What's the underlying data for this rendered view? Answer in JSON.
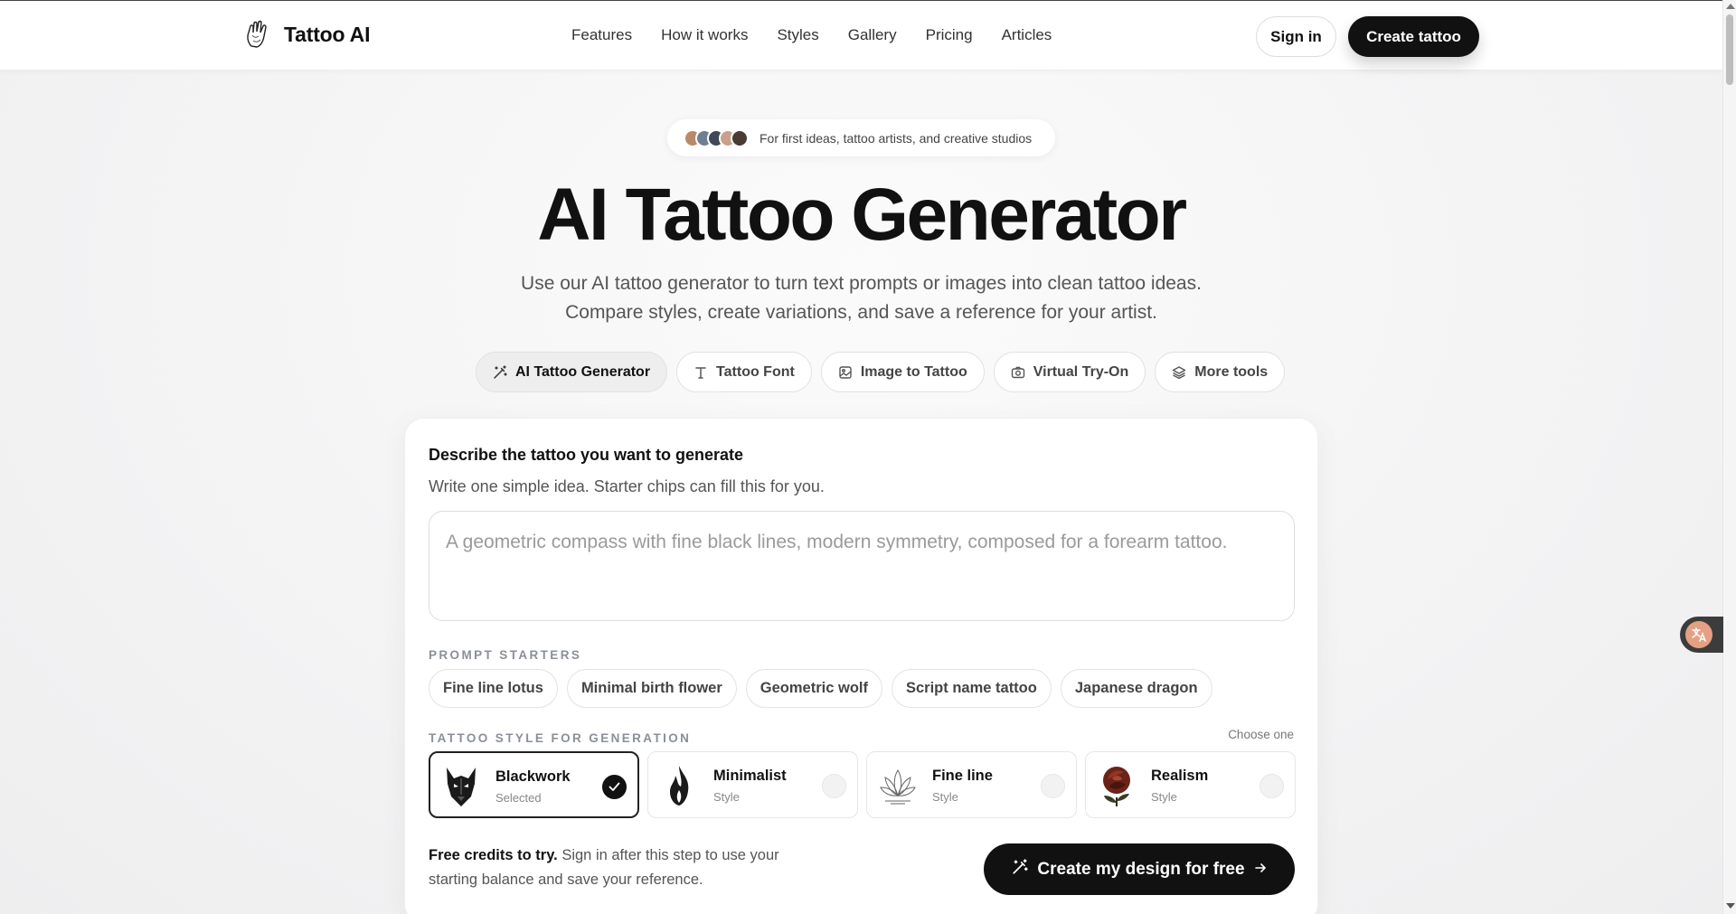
{
  "header": {
    "logo_text": "Tattoo AI",
    "nav": [
      "Features",
      "How it works",
      "Styles",
      "Gallery",
      "Pricing",
      "Articles"
    ],
    "signin": "Sign in",
    "create": "Create tattoo"
  },
  "hero": {
    "pill_text": "For first ideas, tattoo artists, and creative studios",
    "avatar_colors": [
      "#b98a6a",
      "#6e7f93",
      "#3f4a55",
      "#c9a089",
      "#4a3b34"
    ],
    "title": "AI Tattoo Generator",
    "subtitle_line1": "Use our AI tattoo generator to turn text prompts or images into clean tattoo ideas.",
    "subtitle_line2": "Compare styles, create variations, and save a reference for your artist."
  },
  "tools": [
    {
      "label": "AI Tattoo Generator",
      "icon": "wand-icon",
      "active": true
    },
    {
      "label": "Tattoo Font",
      "icon": "type-icon",
      "active": false
    },
    {
      "label": "Image to Tattoo",
      "icon": "image-icon",
      "active": false
    },
    {
      "label": "Virtual Try-On",
      "icon": "camera-icon",
      "active": false
    },
    {
      "label": "More tools",
      "icon": "layers-icon",
      "active": false
    }
  ],
  "form": {
    "title": "Describe the tattoo you want to generate",
    "subtitle": "Write one simple idea. Starter chips can fill this for you.",
    "prompt_placeholder": "A geometric compass with fine black lines, modern symmetry, composed for a forearm tattoo.",
    "prompt_value": "",
    "starters_label": "PROMPT STARTERS",
    "starters": [
      "Fine line lotus",
      "Minimal birth flower",
      "Geometric wolf",
      "Script name tattoo",
      "Japanese dragon"
    ],
    "style_label": "TATTOO STYLE FOR GENERATION",
    "choose_one": "Choose one",
    "styles": [
      {
        "name": "Blackwork",
        "sub": "Selected",
        "selected": true,
        "icon": "wolf-icon"
      },
      {
        "name": "Minimalist",
        "sub": "Style",
        "selected": false,
        "icon": "flame-icon"
      },
      {
        "name": "Fine line",
        "sub": "Style",
        "selected": false,
        "icon": "lotus-icon"
      },
      {
        "name": "Realism",
        "sub": "Style",
        "selected": false,
        "icon": "rose-icon"
      }
    ],
    "free_bold": "Free credits to try.",
    "free_rest": " Sign in after this step to use your starting balance and save your reference.",
    "cta": "Create my design for free"
  },
  "colors": {
    "accent": "#111111",
    "muted": "#555555",
    "label": "#8a8f98"
  }
}
